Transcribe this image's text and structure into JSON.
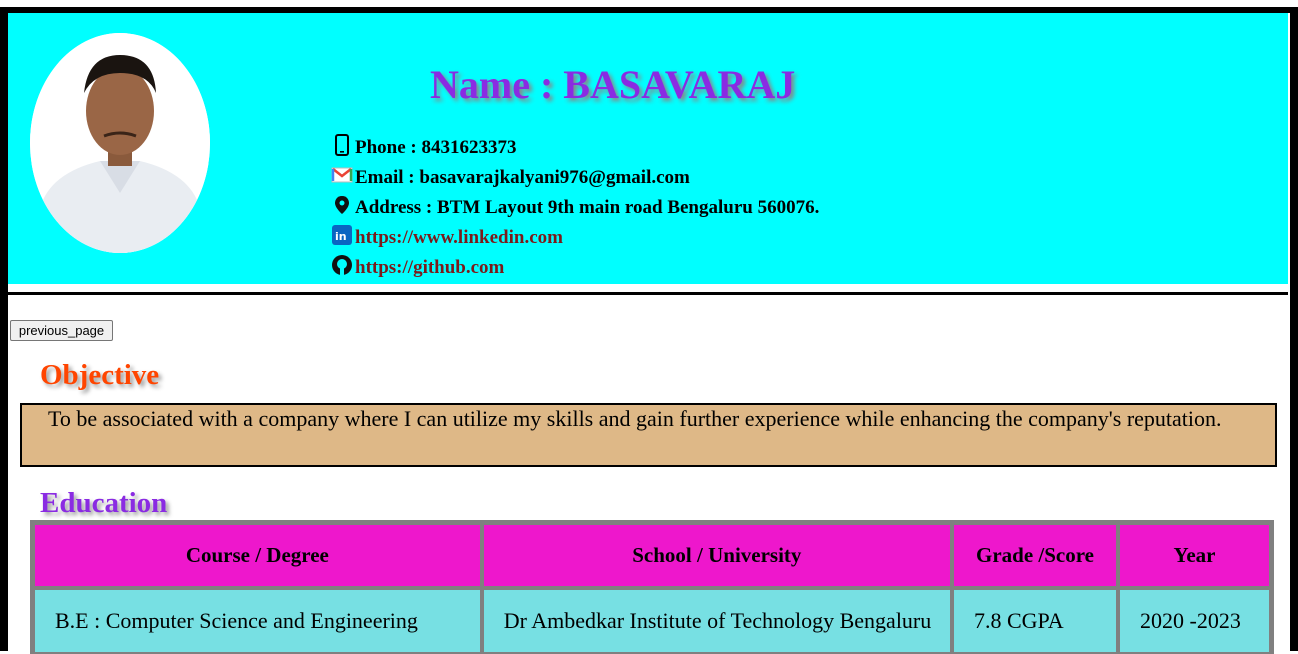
{
  "header": {
    "name": "Name : BASAVARAJ",
    "phone": "Phone : 8431623373",
    "email": "Email : basavarajkalyani976@gmail.com",
    "address": "Address : BTM Layout 9th main road Bengaluru 560076.",
    "linkedin": "https://www.linkedin.com",
    "github": "https://github.com",
    "icons": [
      "phone-icon",
      "gmail-icon",
      "location-icon",
      "linkedin-icon",
      "github-icon"
    ]
  },
  "nav": {
    "previous_label": "previous_page"
  },
  "objective": {
    "title": "Objective",
    "text": "To be associated with a company where I can utilize my skills and gain further experience while enhancing the company's reputation."
  },
  "education": {
    "title": "Education",
    "headers": [
      "Course / Degree",
      "School / University",
      "Grade /Score",
      "Year"
    ],
    "rows": [
      [
        "B.E : Computer Science and Engineering",
        "Dr Ambedkar Institute of Technology Bengaluru",
        "7.8 CGPA",
        "2020 -2023"
      ]
    ]
  },
  "colors": {
    "header_bg": "#00ffff",
    "name": "#8a2be2",
    "objective_title": "#ff4500",
    "objective_bg": "#deb887",
    "table_header_bg": "#ee17cc",
    "table_cell_bg": "#77e0e3"
  }
}
